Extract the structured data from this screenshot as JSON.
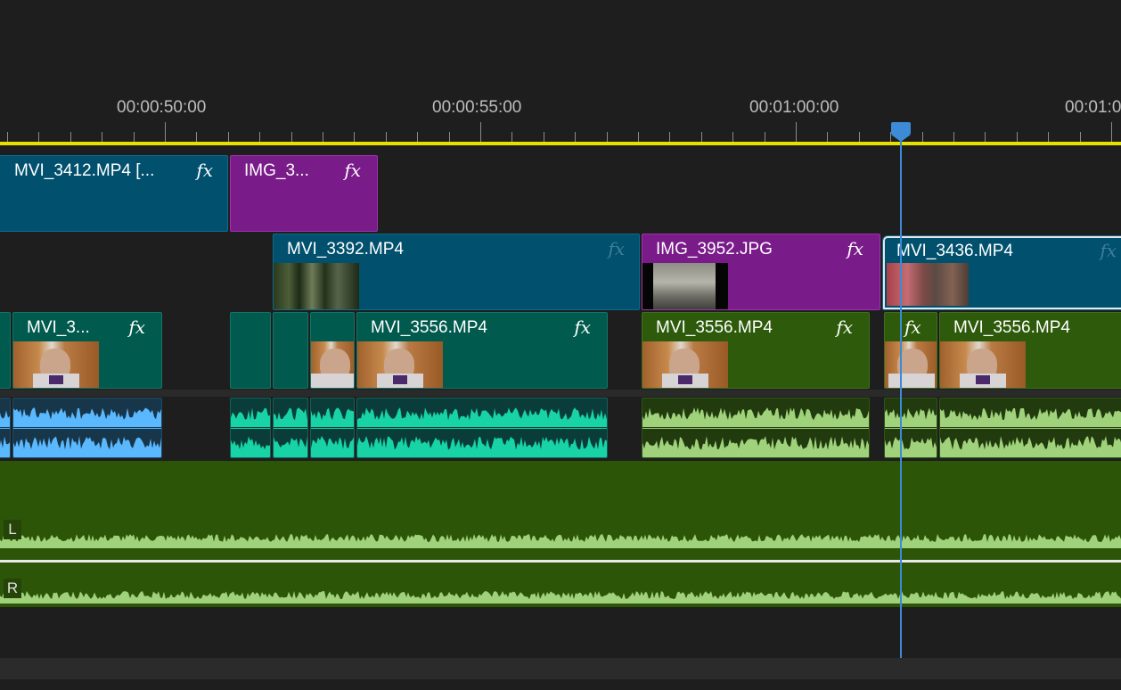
{
  "ruler": {
    "timecodes": [
      "00:00:50:00",
      "00:00:55:00",
      "00:01:00:00",
      "00:01:0"
    ]
  },
  "tracks": {
    "v3": {
      "clips": [
        {
          "name": "MVI_3412.MP4 [...",
          "fx": "fx",
          "color": "blue"
        },
        {
          "name": "IMG_3...",
          "fx": "fx",
          "color": "purple"
        }
      ]
    },
    "v2": {
      "clips": [
        {
          "name": "MVI_3392.MP4",
          "fx": "fx",
          "color": "blue"
        },
        {
          "name": "IMG_3952.JPG",
          "fx": "fx",
          "color": "purple"
        },
        {
          "name": "MVI_3436.MP4",
          "fx": "fx",
          "color": "blue"
        }
      ]
    },
    "v1": {
      "clips": [
        {
          "name": "MVI_3...",
          "fx": "fx",
          "color": "teal"
        },
        {
          "name": "MVI_3556.MP4",
          "fx": "fx",
          "color": "teal"
        },
        {
          "name": "MVI_3556.MP4",
          "fx": "fx",
          "color": "green"
        },
        {
          "name": "fx",
          "color": "green"
        },
        {
          "name": "MVI_3556.MP4",
          "color": "green"
        }
      ]
    },
    "master": {
      "channels": [
        "L",
        "R"
      ]
    }
  },
  "colors": {
    "blue_clip": "#00506e",
    "purple_clip": "#7a1b8a",
    "teal_clip": "#015a4e",
    "green_clip": "#2e5b0b",
    "playhead": "#3c8ad8",
    "work_area": "#e8e000"
  }
}
